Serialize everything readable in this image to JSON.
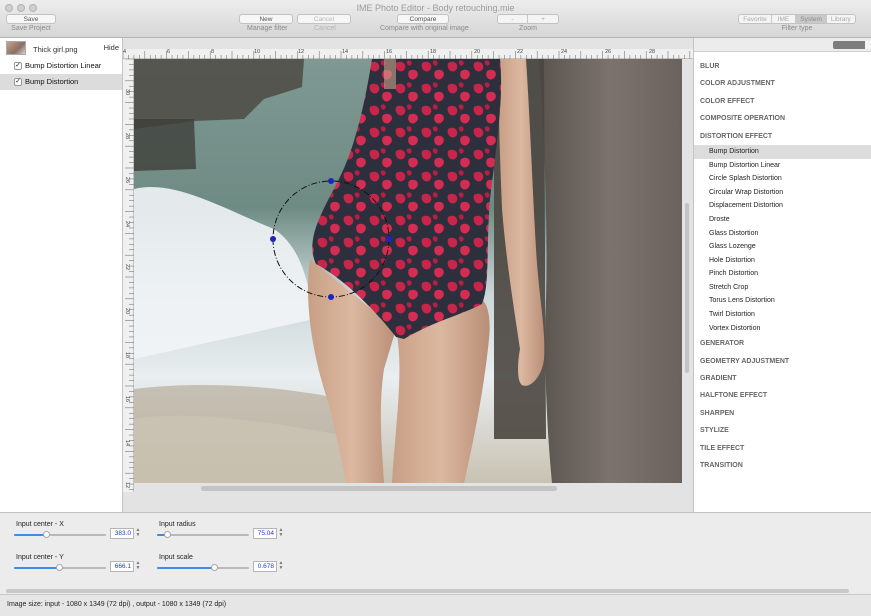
{
  "window": {
    "title": "IME Photo Editor - Body retouching.mie"
  },
  "toolbar": {
    "save_button": "Save",
    "save_caption": "Save Project",
    "new_button": "New",
    "cancel_button": "Cancel",
    "manage_caption": "Manage filter",
    "cancel_caption": "Cancel",
    "compare_button": "Compare",
    "compare_caption": "Compare with original image",
    "zoom_out": "-",
    "zoom_in": "+",
    "zoom_caption": "Zoom",
    "filter_types": [
      "Favorite",
      "IME",
      "System",
      "Library"
    ],
    "filter_type_active": "System",
    "filter_type_caption": "Filter type"
  },
  "layers": {
    "image_name": "Thick girl.png",
    "hide_label": "Hide",
    "items": [
      {
        "label": "Bump Distortion Linear",
        "checked": true,
        "selected": false
      },
      {
        "label": "Bump Distortion",
        "checked": true,
        "selected": true
      }
    ]
  },
  "ruler": {
    "top_ticks": [
      "4",
      "6",
      "8",
      "10",
      "12",
      "14",
      "16",
      "18",
      "20",
      "22",
      "24",
      "26",
      "28"
    ],
    "left_ticks": [
      "30",
      "28",
      "26",
      "24",
      "22",
      "20",
      "18",
      "16",
      "14",
      "12"
    ]
  },
  "filters": {
    "categories": [
      {
        "label": "BLUR",
        "items": []
      },
      {
        "label": "COLOR ADJUSTMENT",
        "items": []
      },
      {
        "label": "COLOR EFFECT",
        "items": []
      },
      {
        "label": "COMPOSITE OPERATION",
        "items": []
      },
      {
        "label": "DISTORTION EFFECT",
        "items": [
          "Bump Distortion",
          "Bump Distortion Linear",
          "Circle Splash Distortion",
          "Circular Wrap Distortion",
          "Displacement Distortion",
          "Droste",
          "Glass Distortion",
          "Glass Lozenge",
          "Hole Distortion",
          "Pinch Distortion",
          "Stretch Crop",
          "Torus Lens Distortion",
          "Twirl Distortion",
          "Vortex Distortion"
        ]
      },
      {
        "label": "GENERATOR",
        "items": []
      },
      {
        "label": "GEOMETRY ADJUSTMENT",
        "items": []
      },
      {
        "label": "GRADIENT",
        "items": []
      },
      {
        "label": "HALFTONE EFFECT",
        "items": []
      },
      {
        "label": "SHARPEN",
        "items": []
      },
      {
        "label": "STYLIZE",
        "items": []
      },
      {
        "label": "TILE EFFECT",
        "items": []
      },
      {
        "label": "TRANSITION",
        "items": []
      }
    ],
    "selected": "Bump Distortion"
  },
  "params": {
    "center_x": {
      "label": "Input center - X",
      "value": "383.0",
      "fraction": 0.35
    },
    "center_y": {
      "label": "Input center - Y",
      "value": "666.1",
      "fraction": 0.49
    },
    "radius": {
      "label": "Input radius",
      "value": "75.04",
      "fraction": 0.11
    },
    "scale": {
      "label": "Input scale",
      "value": "0.678",
      "fraction": 0.62
    }
  },
  "status": {
    "text": "Image size: input - 1080 x 1349 (72 dpi) , output - 1080 x 1349 (72 dpi)"
  },
  "colors": {
    "accent": "#3a8ee8",
    "handle": "#1b24c4",
    "value_text": "#1a3bd6"
  }
}
